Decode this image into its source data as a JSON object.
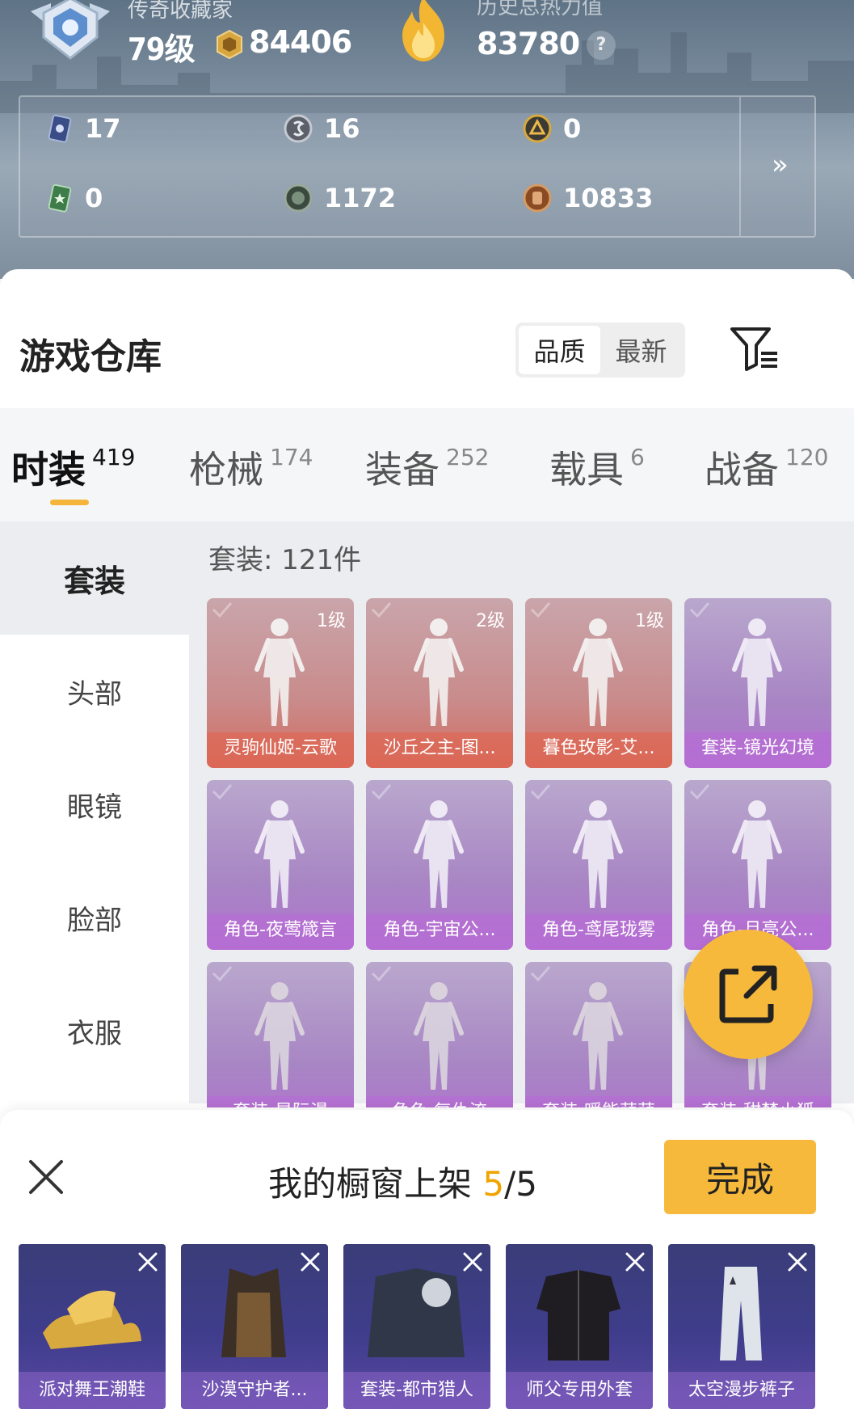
{
  "header": {
    "title": "传奇收藏家",
    "level": "79级",
    "coins": "84406",
    "heat_label": "历史总热力值",
    "heat_value": "83780",
    "help": "?"
  },
  "stats": [
    {
      "icon": "card-icon",
      "value": "17"
    },
    {
      "icon": "silver-coin-icon",
      "value": "16"
    },
    {
      "icon": "gold-badge-icon",
      "value": "0"
    },
    {
      "icon": "green-card-icon",
      "value": "0"
    },
    {
      "icon": "orb-icon",
      "value": "1172"
    },
    {
      "icon": "bronze-coin-icon",
      "value": "10833"
    }
  ],
  "warehouse": {
    "title": "游戏仓库",
    "sort_options": [
      "品质",
      "最新"
    ],
    "sort_active": "品质"
  },
  "tabs": [
    {
      "label": "时装",
      "count": "419",
      "active": true
    },
    {
      "label": "枪械",
      "count": "174",
      "active": false
    },
    {
      "label": "装备",
      "count": "252",
      "active": false
    },
    {
      "label": "载具",
      "count": "6",
      "active": false
    },
    {
      "label": "战备",
      "count": "120",
      "active": false
    }
  ],
  "sidebar": {
    "items": [
      "套装",
      "头部",
      "眼镜",
      "脸部",
      "衣服"
    ],
    "active": "套装"
  },
  "count_label": "套装: 121件",
  "items": [
    {
      "name": "灵驹仙姬-云歌",
      "level": "1级",
      "color": "red"
    },
    {
      "name": "沙丘之主-图...",
      "level": "2级",
      "color": "red"
    },
    {
      "name": "暮色玫影-艾...",
      "level": "1级",
      "color": "red"
    },
    {
      "name": "套装-镜光幻境",
      "level": "",
      "color": "purple"
    },
    {
      "name": "角色-夜莺箴言",
      "level": "",
      "color": "purple"
    },
    {
      "name": "角色-宇宙公...",
      "level": "",
      "color": "purple"
    },
    {
      "name": "角色-鸢尾珑雾",
      "level": "",
      "color": "purple"
    },
    {
      "name": "角色-月亮公...",
      "level": "",
      "color": "purple"
    },
    {
      "name": "套装-星际漫",
      "level": "",
      "color": "purple"
    },
    {
      "name": "角色-复仇流",
      "level": "",
      "color": "purple"
    },
    {
      "name": "套装-暖能萌萌",
      "level": "",
      "color": "purple"
    },
    {
      "name": "套装-甜梦小狐",
      "level": "",
      "color": "purple"
    }
  ],
  "showcase": {
    "title_prefix": "我的橱窗上架 ",
    "current": "5",
    "total": "/5",
    "done_label": "完成",
    "items": [
      "派对舞王潮鞋",
      "沙漠守护者...",
      "套装-都市猎人",
      "师父专用外套",
      "太空漫步裤子"
    ]
  },
  "colors": {
    "accent": "#f6b93b",
    "red_tile": "#c98b8b",
    "purple_tile": "#a886c4",
    "showcase_tile": "#3f3d8c"
  }
}
